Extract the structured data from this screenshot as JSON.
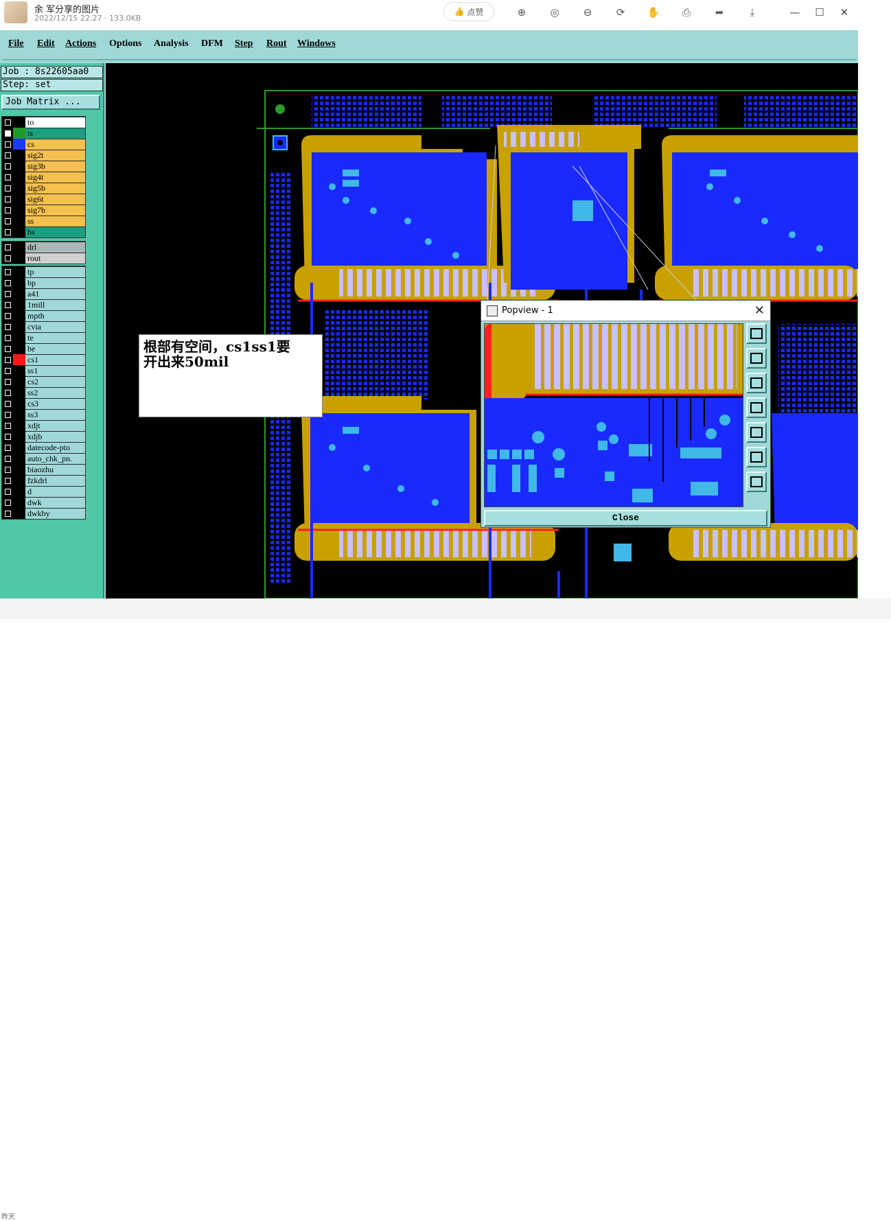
{
  "viewer": {
    "title": "余  军分享的图片",
    "meta": "2022/12/15 22:27 · 133.0KB",
    "like_label": "点赞",
    "tools": [
      "zoom-in-icon",
      "actual-size-icon",
      "zoom-out-icon",
      "rotate-icon",
      "hand-icon",
      "print-icon",
      "share-icon",
      "download-icon"
    ],
    "bottom_text": "昨天"
  },
  "menu": [
    "File",
    "Edit",
    "Actions",
    "Options",
    "Analysis",
    "DFM",
    "Step",
    "Rout",
    "Windows"
  ],
  "job": {
    "job_label": "Job : 8s22605aa0",
    "step_label": "Step: set",
    "matrix_button": "Job Matrix ..."
  },
  "layers": {
    "board": [
      {
        "name": "to",
        "color": "#ffffff",
        "swatch": "#000000",
        "checked": false
      },
      {
        "name": "ts",
        "color": "#1aa080",
        "swatch": "#1f9a2a",
        "checked": true
      },
      {
        "name": "cs",
        "color": "#f5c050",
        "swatch": "#1a3aff",
        "checked": false
      },
      {
        "name": "sig2t",
        "color": "#f5c050",
        "swatch": "#000000",
        "checked": false
      },
      {
        "name": "sig3b",
        "color": "#f5c050",
        "swatch": "#000000",
        "checked": false
      },
      {
        "name": "sig4t",
        "color": "#f5c050",
        "swatch": "#000000",
        "checked": false
      },
      {
        "name": "sig5b",
        "color": "#f5c050",
        "swatch": "#000000",
        "checked": false
      },
      {
        "name": "sig6t",
        "color": "#f5c050",
        "swatch": "#000000",
        "checked": false
      },
      {
        "name": "sig7b",
        "color": "#f5c050",
        "swatch": "#000000",
        "checked": false
      },
      {
        "name": "ss",
        "color": "#f5c050",
        "swatch": "#000000",
        "checked": false
      },
      {
        "name": "bs",
        "color": "#1aa080",
        "swatch": "#000000",
        "checked": false
      }
    ],
    "drill": [
      {
        "name": "drl",
        "color": "#a8b8b8",
        "swatch": "#000000",
        "checked": false
      },
      {
        "name": "rout",
        "color": "#d0d0d0",
        "swatch": "#000000",
        "checked": false
      }
    ],
    "misc": [
      {
        "name": "tp",
        "color": "#a0d8d8",
        "swatch": "#000000",
        "checked": false
      },
      {
        "name": "bp",
        "color": "#a0d8d8",
        "swatch": "#000000",
        "checked": false
      },
      {
        "name": "a41",
        "color": "#a0d8d8",
        "swatch": "#000000",
        "checked": false
      },
      {
        "name": "1mill",
        "color": "#a0d8d8",
        "swatch": "#000000",
        "checked": false
      },
      {
        "name": "mpth",
        "color": "#a0d8d8",
        "swatch": "#000000",
        "checked": false
      },
      {
        "name": "cvia",
        "color": "#a0d8d8",
        "swatch": "#000000",
        "checked": false
      },
      {
        "name": "te",
        "color": "#a0d8d8",
        "swatch": "#000000",
        "checked": false
      },
      {
        "name": "be",
        "color": "#a0d8d8",
        "swatch": "#000000",
        "checked": false
      },
      {
        "name": "cs1",
        "color": "#a0d8d8",
        "swatch": "#ff1a1a",
        "checked": false
      },
      {
        "name": "ss1",
        "color": "#a0d8d8",
        "swatch": "#000000",
        "checked": false
      },
      {
        "name": "cs2",
        "color": "#a0d8d8",
        "swatch": "#000000",
        "checked": false
      },
      {
        "name": "ss2",
        "color": "#a0d8d8",
        "swatch": "#000000",
        "checked": false
      },
      {
        "name": "cs3",
        "color": "#a0d8d8",
        "swatch": "#000000",
        "checked": false
      },
      {
        "name": "ss3",
        "color": "#a0d8d8",
        "swatch": "#000000",
        "checked": false
      },
      {
        "name": "xdjt",
        "color": "#a0d8d8",
        "swatch": "#000000",
        "checked": false
      },
      {
        "name": "xdjb",
        "color": "#a0d8d8",
        "swatch": "#000000",
        "checked": false
      },
      {
        "name": "datecode-pto",
        "color": "#a0d8d8",
        "swatch": "#000000",
        "checked": false
      },
      {
        "name": "auto_chk_pn.",
        "color": "#a0d8d8",
        "swatch": "#000000",
        "checked": false
      },
      {
        "name": "biaozhu",
        "color": "#a0d8d8",
        "swatch": "#000000",
        "checked": false
      },
      {
        "name": "fzkdrl",
        "color": "#a0d8d8",
        "swatch": "#000000",
        "checked": false
      },
      {
        "name": "d",
        "color": "#a0d8d8",
        "swatch": "#000000",
        "checked": false
      },
      {
        "name": "dwk",
        "color": "#a0d8d8",
        "swatch": "#000000",
        "checked": false
      },
      {
        "name": "dwkby",
        "color": "#a0d8d8",
        "swatch": "#000000",
        "checked": false
      }
    ]
  },
  "note": {
    "line1": "根部有空间，cs1ss1要",
    "line2": "开出来50mil"
  },
  "popview": {
    "title": "Popview - 1",
    "close_label": "Close",
    "tools": [
      "zoom-fit-icon",
      "pan-up-icon",
      "pan-down-icon",
      "pan-left-icon",
      "pan-right-icon",
      "zoom-in-box-icon",
      "zoom-out-box-icon"
    ]
  },
  "colors": {
    "copper": "#c8a000",
    "blue_fill": "#1a2aff",
    "pad": "#40b8e8",
    "finger": "#c8c0ff",
    "green_trace": "#2a9a2a",
    "red_edge": "#ff2020"
  }
}
